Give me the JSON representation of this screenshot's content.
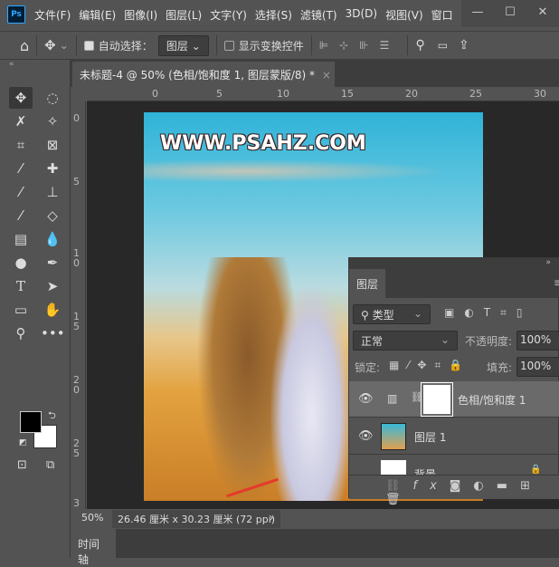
{
  "app": {
    "logo": "Ps"
  },
  "menu": [
    "文件(F)",
    "编辑(E)",
    "图像(I)",
    "图层(L)",
    "文字(Y)",
    "选择(S)",
    "滤镜(T)",
    "3D(D)",
    "视图(V)",
    "窗口"
  ],
  "window_controls": {
    "minimize": "—",
    "maximize": "☐",
    "close": "✕"
  },
  "options": {
    "auto_select_label": "自动选择：",
    "auto_select_checked": true,
    "auto_select_value": "图层",
    "show_transform_label": "显示变换控件",
    "show_transform_checked": false
  },
  "document_tab": {
    "title": "未标题-4 @ 50% (色相/饱和度 1, 图层蒙版/8) *",
    "close": "×"
  },
  "ruler_top": [
    "0",
    "5",
    "10",
    "15",
    "20",
    "25",
    "30"
  ],
  "ruler_left": [
    "0",
    "5",
    "10",
    "15",
    "20",
    "25",
    "3"
  ],
  "canvas": {
    "watermark": "WWW.PSAHZ.COM"
  },
  "status": {
    "zoom": "50%",
    "doc_size": "26.46 厘米 x 30.23 厘米 (72 ppi)",
    "arrow": "›"
  },
  "timeline": {
    "tab": "时间轴"
  },
  "colors": {
    "foreground": "#000000",
    "background": "#ffffff",
    "accent": "#31a8ff"
  },
  "layers_panel": {
    "title": "图层",
    "filter": "类型",
    "blend_mode": "正常",
    "opacity_label": "不透明度:",
    "opacity": "100%",
    "lock_label": "锁定:",
    "fill_label": "填充:",
    "fill": "100%",
    "layers": [
      {
        "name": "色相/饱和度 1",
        "type": "adjustment",
        "visible": true,
        "selected": true
      },
      {
        "name": "图层 1",
        "type": "image",
        "visible": true,
        "selected": false
      },
      {
        "name": "背景",
        "type": "background",
        "visible": true,
        "selected": false,
        "locked": true
      }
    ]
  }
}
